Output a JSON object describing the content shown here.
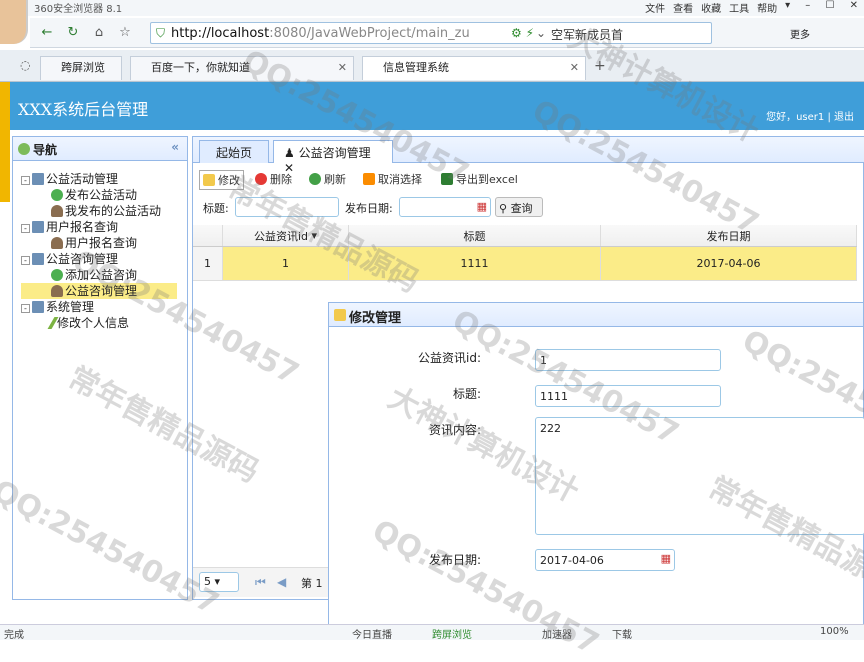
{
  "browser": {
    "title": "360安全浏览器 8.1",
    "menu": [
      "文件",
      "查看",
      "收藏",
      "工具",
      "帮助"
    ],
    "url_host": "http://localhost",
    "url_path": ":8080/JavaWebProject/main_zu",
    "search_text": "空军新成员首",
    "more_label": "更多",
    "tabs": [
      {
        "label": "跨屏浏览"
      },
      {
        "label": "百度一下，你就知道"
      },
      {
        "label": "信息管理系统"
      }
    ],
    "status": {
      "left": "完成",
      "items": [
        "今日直播",
        "跨屏浏览",
        "加速器",
        "下载",
        "100%"
      ]
    }
  },
  "app": {
    "header_title": "XXX系统后台管理",
    "user_text": "您好，user1 | 退出"
  },
  "nav": {
    "title": "导航",
    "collapse": "«",
    "groups": [
      {
        "label": "公益活动管理",
        "children": [
          "发布公益活动",
          "我发布的公益活动"
        ]
      },
      {
        "label": "用户报名查询",
        "children": [
          "用户报名查询"
        ]
      },
      {
        "label": "公益咨询管理",
        "children": [
          "添加公益咨询",
          "公益咨询管理"
        ]
      },
      {
        "label": "系统管理",
        "children": [
          "修改个人信息"
        ]
      }
    ]
  },
  "center": {
    "tabs": [
      "起始页",
      "公益咨询管理"
    ],
    "toolbar": [
      "修改",
      "删除",
      "刷新",
      "取消选择",
      "导出到excel"
    ],
    "search": {
      "title_label": "标题:",
      "date_label": "发布日期:",
      "button": "查询"
    },
    "grid": {
      "columns": [
        "公益资讯id",
        "标题",
        "发布日期"
      ],
      "rows": [
        {
          "num": "1",
          "id": "1",
          "title": "1111",
          "date": "2017-04-06"
        }
      ]
    },
    "pager": {
      "size": "5",
      "page_label": "第 1"
    }
  },
  "dialog": {
    "title": "修改管理",
    "fields": [
      {
        "label": "公益资讯id:",
        "value": "1"
      },
      {
        "label": "标题:",
        "value": "1111"
      },
      {
        "label": "资讯内容:",
        "value": "222"
      },
      {
        "label": "发布日期:",
        "value": "2017-04-06"
      }
    ]
  },
  "watermarks": [
    "QQ:254540457",
    "大神计算机设计",
    "常年售精品源码"
  ],
  "colors": {
    "header": "#3f9ed9",
    "selected_row": "#fbec88",
    "panel_border": "#95b8e7"
  }
}
